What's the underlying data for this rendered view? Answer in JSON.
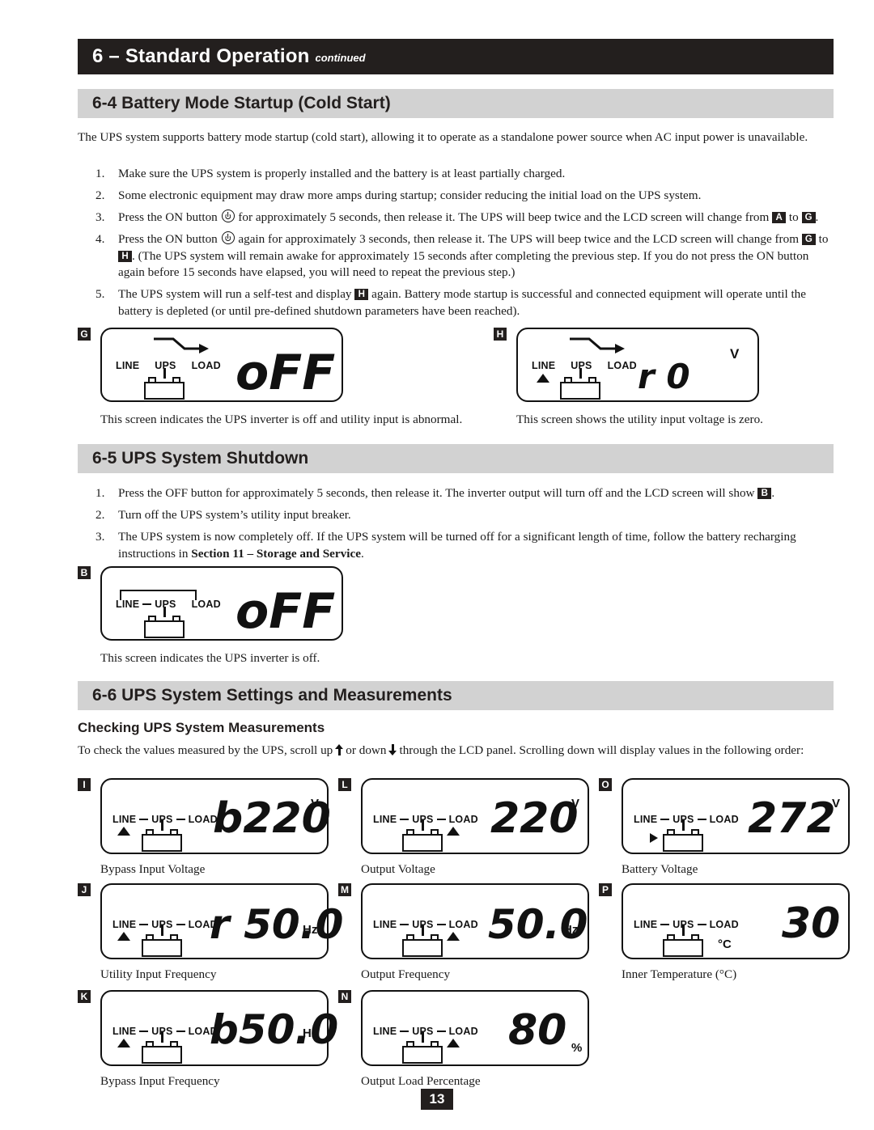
{
  "header": {
    "title": "6 – Standard Operation",
    "continued": "continued"
  },
  "sections": {
    "s64": {
      "heading": "6-4 Battery Mode Startup (Cold Start)",
      "intro": "The UPS system supports battery mode startup (cold start), allowing it to operate as a standalone power source when AC input power is unavailable.",
      "steps": [
        {
          "num": "1.",
          "text": "Make sure the UPS system is properly installed and the battery is at least partially charged."
        },
        {
          "num": "2.",
          "text": "Some electronic equipment may draw more amps during startup; consider reducing the initial load on the UPS system."
        },
        {
          "num": "3.",
          "pre": "Press the ON button",
          "post_a": "for approximately 5 seconds, then release it. The UPS will beep twice and the LCD screen will change from",
          "badge1": "A",
          "mid": "to",
          "badge2": "G",
          "post_b": "."
        },
        {
          "num": "4.",
          "pre": "Press the ON button",
          "post_a": "again for approximately 3 seconds, then release it. The UPS will beep twice and the LCD screen will change from",
          "badge1": "G",
          "mid": "to",
          "badge2": "H",
          "post_b": ". (The UPS system will remain awake for approximately 15 seconds after completing the previous step. If you do not press the ON button again before 15 seconds have elapsed, you will need to repeat the previous step.)"
        },
        {
          "num": "5.",
          "pre": "The UPS system will run a self-test and display",
          "badge1": "H",
          "post_a": "again. Battery mode startup is successful and connected equipment will operate until the battery is depleted (or until pre-defined shutdown parameters have been reached)."
        }
      ]
    },
    "s65": {
      "heading": "6-5 UPS System Shutdown",
      "steps": [
        {
          "num": "1.",
          "pre": "Press the OFF button for approximately 5 seconds, then release it. The inverter output will turn off and the LCD screen will show",
          "badge1": "B",
          "post_a": "."
        },
        {
          "num": "2.",
          "text": "Turn off the UPS system’s utility input breaker."
        },
        {
          "num": "3.",
          "pre": "The UPS system is now completely off. If the UPS system will be turned off for a significant length of time, follow the battery recharging instructions in",
          "bold": "Section 11 – Storage and Service",
          "post_a": "."
        }
      ]
    },
    "s66": {
      "heading": "6-6 UPS System Settings and Measurements",
      "subheading": "Checking UPS System Measurements",
      "intro_pre": "To check the values measured by the UPS, scroll up",
      "intro_mid": "or down",
      "intro_post": "through the LCD panel. Scrolling down will display values in the following order:"
    }
  },
  "figures": {
    "G": {
      "key": "G",
      "labels": {
        "line": "LINE",
        "ups": "UPS",
        "load": "LOAD"
      },
      "value": "oFF",
      "unit": "",
      "caption": "This screen indicates the UPS inverter is off and utility input is abnormal.",
      "markers": {
        "zigzag": true,
        "battery": true,
        "line_tri": false,
        "load_tri": false,
        "bat_tri": false,
        "linked": false
      }
    },
    "H": {
      "key": "H",
      "labels": {
        "line": "LINE",
        "ups": "UPS",
        "load": "LOAD"
      },
      "value": "r 0",
      "unit": "V",
      "caption": "This screen shows the utility input voltage is zero.",
      "markers": {
        "zigzag": true,
        "battery": true,
        "line_tri": true,
        "load_tri": false,
        "bat_tri": false,
        "linked": false
      }
    },
    "B": {
      "key": "B",
      "labels": {
        "line": "LINE",
        "ups": "UPS",
        "load": "LOAD"
      },
      "value": "oFF",
      "unit": "",
      "caption": "This screen indicates the UPS inverter is off.",
      "markers": {
        "zigzag": false,
        "battery": true,
        "line_tri": false,
        "load_tri": false,
        "bat_tri": false,
        "linked": false,
        "bracket": true
      }
    },
    "I": {
      "key": "I",
      "labels": {
        "line": "LINE",
        "ups": "UPS",
        "load": "LOAD"
      },
      "value": "b220",
      "unit": "V",
      "caption": "Bypass Input Voltage",
      "markers": {
        "zigzag": false,
        "battery": true,
        "line_tri": true,
        "load_tri": false,
        "bat_tri": false,
        "linked": true
      }
    },
    "L": {
      "key": "L",
      "labels": {
        "line": "LINE",
        "ups": "UPS",
        "load": "LOAD"
      },
      "value": "220",
      "unit": "V",
      "caption": "Output Voltage",
      "markers": {
        "zigzag": false,
        "battery": true,
        "line_tri": false,
        "load_tri": true,
        "bat_tri": false,
        "linked": true
      }
    },
    "O": {
      "key": "O",
      "labels": {
        "line": "LINE",
        "ups": "UPS",
        "load": "LOAD"
      },
      "value": "272",
      "unit": "V",
      "caption": "Battery Voltage",
      "markers": {
        "zigzag": false,
        "battery": true,
        "line_tri": false,
        "load_tri": false,
        "bat_tri": true,
        "linked": true
      }
    },
    "J": {
      "key": "J",
      "labels": {
        "line": "LINE",
        "ups": "UPS",
        "load": "LOAD"
      },
      "value": "r 50.0",
      "unit": "Hz",
      "caption": "Utility Input Frequency",
      "markers": {
        "zigzag": false,
        "battery": true,
        "line_tri": true,
        "load_tri": false,
        "bat_tri": false,
        "linked": true
      }
    },
    "M": {
      "key": "M",
      "labels": {
        "line": "LINE",
        "ups": "UPS",
        "load": "LOAD"
      },
      "value": "50.0",
      "unit": "Hz",
      "caption": "Output Frequency",
      "markers": {
        "zigzag": false,
        "battery": true,
        "line_tri": false,
        "load_tri": true,
        "bat_tri": false,
        "linked": true
      }
    },
    "P": {
      "key": "P",
      "labels": {
        "line": "LINE",
        "ups": "UPS",
        "load": "LOAD"
      },
      "value": "30",
      "unit": "",
      "inner_unit": "°C",
      "caption": "Inner Temperature (°C)",
      "markers": {
        "zigzag": false,
        "battery": true,
        "line_tri": false,
        "load_tri": false,
        "bat_tri": false,
        "linked": true
      }
    },
    "K": {
      "key": "K",
      "labels": {
        "line": "LINE",
        "ups": "UPS",
        "load": "LOAD"
      },
      "value": "b50.0",
      "unit": "Hz",
      "caption": "Bypass Input Frequency",
      "markers": {
        "zigzag": false,
        "battery": true,
        "line_tri": true,
        "load_tri": false,
        "bat_tri": false,
        "linked": true
      }
    },
    "N": {
      "key": "N",
      "labels": {
        "line": "LINE",
        "ups": "UPS",
        "load": "LOAD"
      },
      "value": "80",
      "unit": "%",
      "caption": "Output Load Percentage",
      "markers": {
        "zigzag": false,
        "battery": true,
        "line_tri": false,
        "load_tri": true,
        "bat_tri": false,
        "linked": true
      }
    }
  },
  "page_number": "13"
}
